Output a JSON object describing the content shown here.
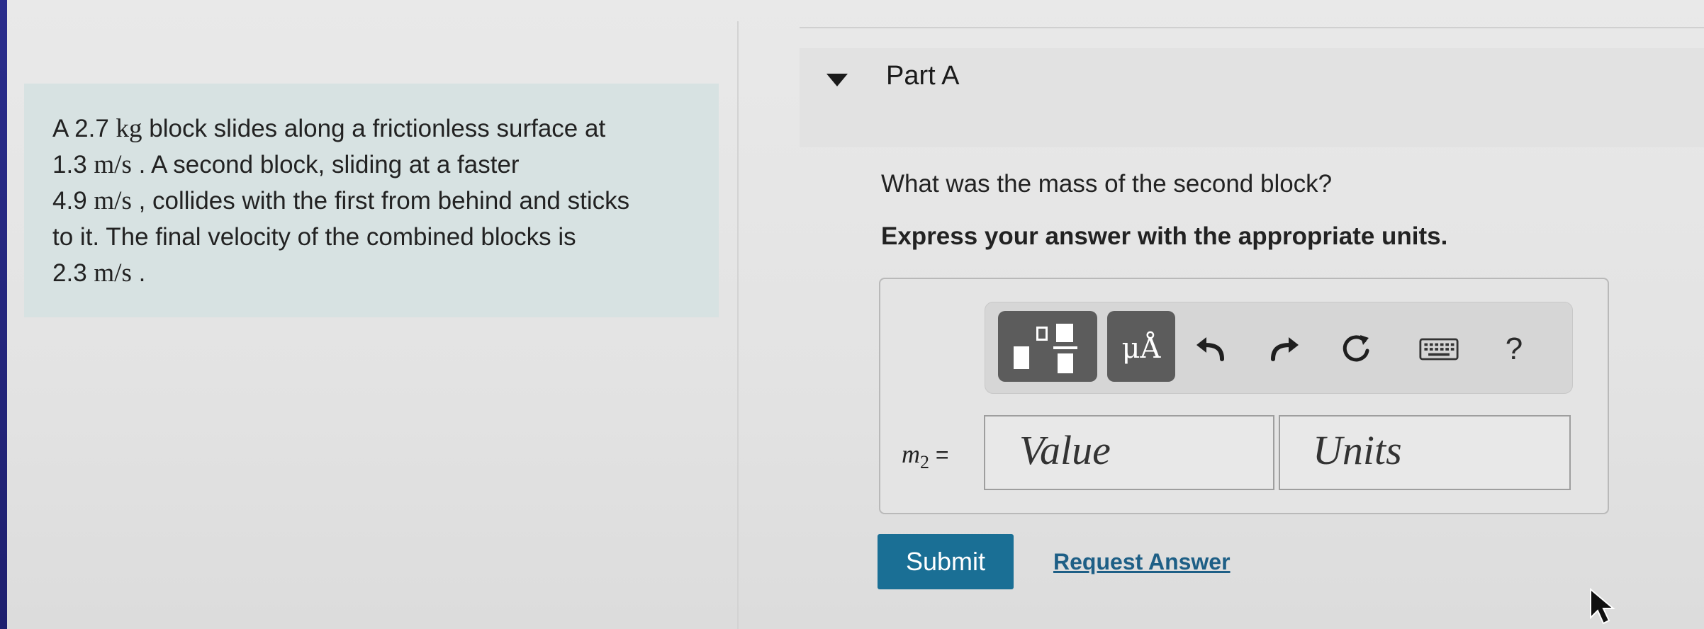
{
  "problem": {
    "seg1": "A 2.7 ",
    "unit_kg": "kg",
    "seg2": " block slides along a frictionless surface at",
    "v1": "1.3 ",
    "unit1": "m/s",
    "seg3": " . A second block, sliding at a faster",
    "v2": "4.9 ",
    "unit2": "m/s",
    "seg4": " , collides with the first from behind and sticks",
    "seg5": "to it. The final velocity of the combined blocks is",
    "v3": "2.3 ",
    "unit3": "m/s",
    "seg6": " ."
  },
  "part": {
    "title": "Part A",
    "question": "What was the mass of the second block?",
    "instruction": "Express your answer with the appropriate units."
  },
  "toolbar": {
    "units_glyph": "μÅ",
    "help_label": "?",
    "icons": [
      "templates-icon",
      "units-icon",
      "undo-icon",
      "redo-icon",
      "reset-icon",
      "keyboard-icon",
      "help-icon"
    ]
  },
  "answer": {
    "var_main": "m",
    "var_sub": "2",
    "equals": " =",
    "value_placeholder": "Value",
    "units_placeholder": "Units"
  },
  "actions": {
    "submit_label": "Submit",
    "request_label": "Request Answer"
  },
  "colors": {
    "problem_bg": "#d7e2e2",
    "submit_bg": "#1a6f95",
    "link": "#1e5f86",
    "toolbar_button": "#5c5c5c"
  }
}
